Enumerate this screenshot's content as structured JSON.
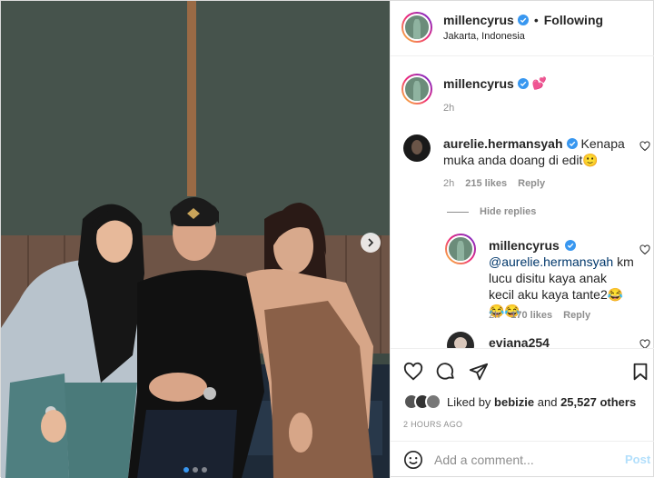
{
  "header": {
    "username": "millencyrus",
    "separator": "•",
    "follow_status": "Following",
    "location": "Jakarta, Indonesia"
  },
  "caption": {
    "username": "millencyrus",
    "text": "💕",
    "time": "2h"
  },
  "comments": [
    {
      "username": "aurelie.hermansyah",
      "text": "Kenapa muka anda doang di edit🙂",
      "time": "2h",
      "likes": "215 likes",
      "reply_label": "Reply"
    }
  ],
  "hide_replies_label": "Hide replies",
  "reply": {
    "username": "millencyrus",
    "mention": "@aurelie.hermansyah",
    "text": "km lucu disitu kaya anak kecil aku kaya tante2😂😂😂",
    "time": "2h",
    "likes": "170 likes",
    "reply_label": "Reply"
  },
  "next_comment": {
    "username": "eviana254"
  },
  "likes": {
    "prefix": "Liked by",
    "user": "bebizie",
    "middle": "and",
    "count": "25,527 others"
  },
  "timestamp": "2 HOURS AGO",
  "add_comment": {
    "placeholder": "Add a comment...",
    "post_label": "Post"
  },
  "carousel": {
    "total": 3,
    "active": 1
  },
  "colors": {
    "verified": "#3897f0",
    "link": "#00376b",
    "muted": "#8e8e8e",
    "post_disabled": "#b2dffc"
  },
  "icons": [
    "verified-icon",
    "heart-icon",
    "comment-icon",
    "share-icon",
    "bookmark-icon",
    "emoji-icon",
    "chevron-right-icon"
  ]
}
